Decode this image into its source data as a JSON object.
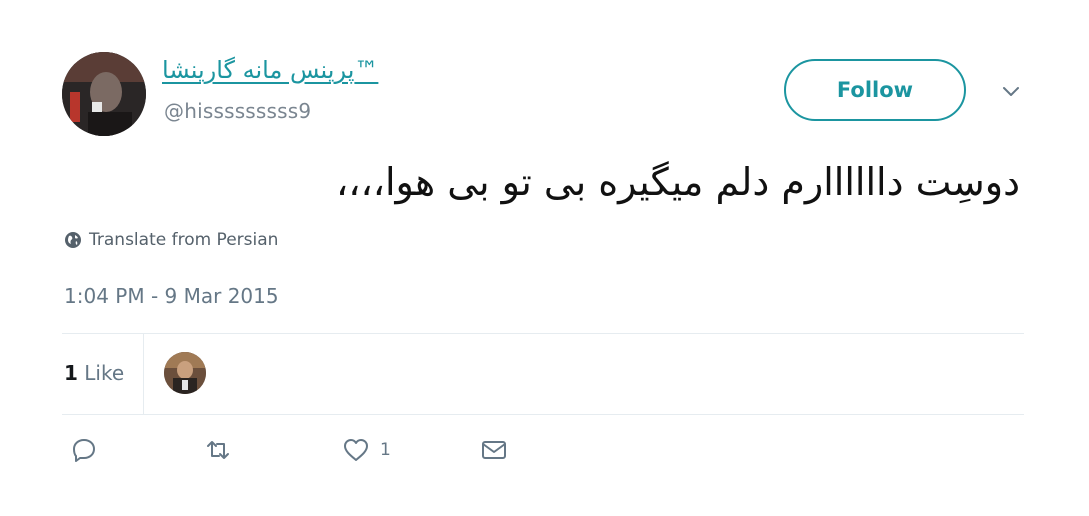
{
  "author": {
    "display_name": "پرینس مانه گارینشا™",
    "handle": "@hisssssssss9"
  },
  "header": {
    "follow_label": "Follow"
  },
  "tweet": {
    "text": "دوسِت داااااارم دلم میگیره بی تو بی هوا،،،،",
    "translate_label": "Translate from Persian",
    "timestamp": "1:04 PM - 9 Mar 2015"
  },
  "stats": {
    "likes_count": "1",
    "likes_label": "Like"
  },
  "actions": {
    "like_count": "1"
  },
  "colors": {
    "accent": "#1b95a0",
    "muted": "#657786",
    "divider": "#e6ecf0"
  },
  "icons": [
    "reply-icon",
    "retweet-icon",
    "heart-icon",
    "message-icon",
    "globe-icon",
    "chevron-down-icon"
  ]
}
